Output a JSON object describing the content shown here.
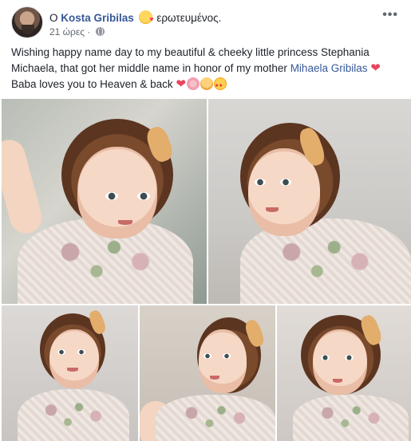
{
  "post": {
    "author_prefix": "Ο",
    "author_name": "Kosta Gribilas",
    "feeling": "ερωτευμένος.",
    "timestamp": "21 ώρες",
    "privacy_icon": "globe-icon",
    "more_icon": "ellipsis-icon",
    "text_part1": "Wishing happy name day to my beautiful & cheeky little princess Stephania Michaela, that got her middle name in honor of my mother ",
    "mention": "Mihaela Gribilas",
    "heart": "❤",
    "text_line2": "Baba loves you to Heaven & back",
    "photos_count": 5
  },
  "colors": {
    "link": "#365899",
    "text": "#1d2129",
    "meta": "#616770",
    "heart": "#e8455d"
  }
}
